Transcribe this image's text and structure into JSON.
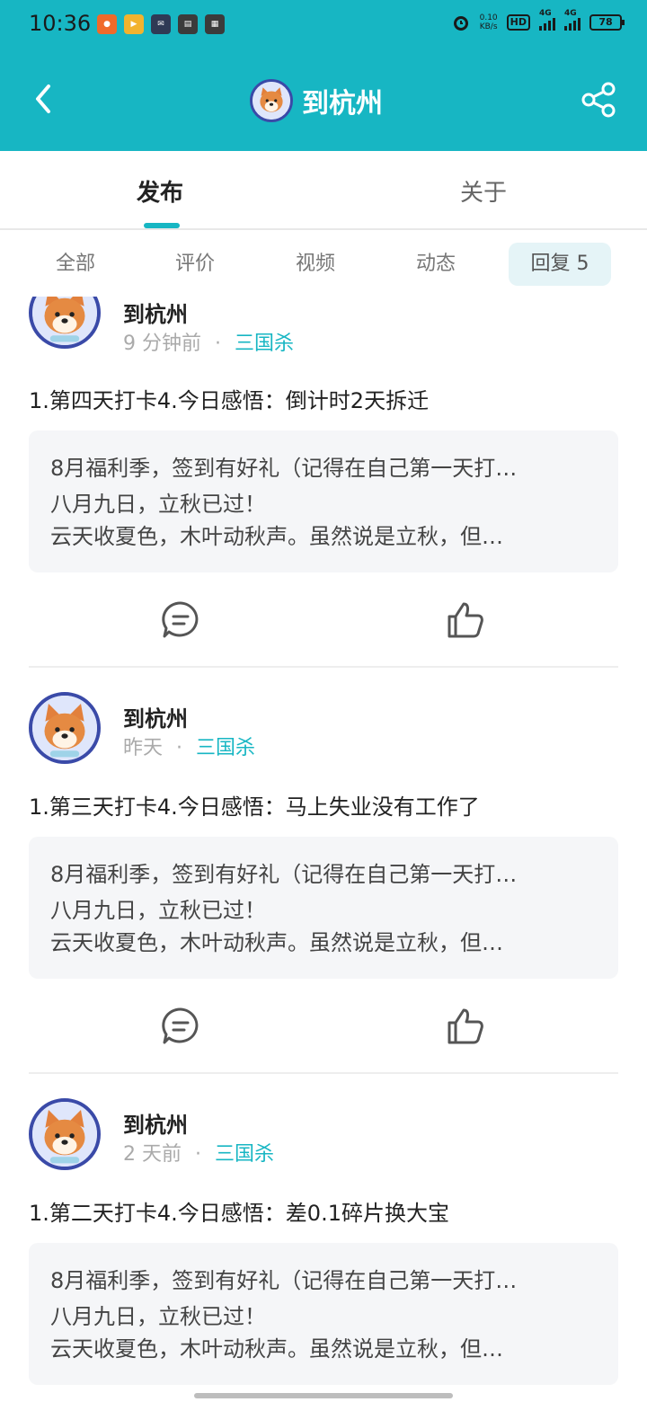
{
  "status": {
    "time": "10:36",
    "speed_value": "0.10",
    "speed_unit": "KB/s",
    "hd": "HD",
    "net1": "4G",
    "net2": "4G",
    "battery": "78"
  },
  "header": {
    "title": "到杭州"
  },
  "tabs": [
    "发布",
    "关于"
  ],
  "filters": [
    "全部",
    "评价",
    "视频",
    "动态",
    "回复 5"
  ],
  "posts": [
    {
      "author": "到杭州",
      "time": "9 分钟前",
      "separator": "·",
      "game": "三国杀",
      "text": "1.第四天打卡4.今日感悟：倒计时2天拆迁",
      "quote": [
        "8月福利季，签到有好礼（记得在自己第一天打…",
        "八月九日，立秋已过！",
        "云天收夏色，木叶动秋声。虽然说是立秋，但…"
      ]
    },
    {
      "author": "到杭州",
      "time": "昨天",
      "separator": "·",
      "game": "三国杀",
      "text": "1.第三天打卡4.今日感悟：马上失业没有工作了",
      "quote": [
        "8月福利季，签到有好礼（记得在自己第一天打…",
        "八月九日，立秋已过！",
        "云天收夏色，木叶动秋声。虽然说是立秋，但…"
      ]
    },
    {
      "author": "到杭州",
      "time": "2 天前",
      "separator": "·",
      "game": "三国杀",
      "text": "1.第二天打卡4.今日感悟：差0.1碎片换大宝",
      "quote": [
        "8月福利季，签到有好礼（记得在自己第一天打…",
        "八月九日，立秋已过！",
        "云天收夏色，木叶动秋声。虽然说是立秋，但…"
      ]
    }
  ],
  "colors": {
    "accent": "#17b6c3",
    "avatar_ring": "#3a4aa8"
  },
  "icons": {
    "back": "back-arrow-icon",
    "share": "share-icon",
    "comment": "comment-icon",
    "like": "thumbs-up-icon"
  }
}
